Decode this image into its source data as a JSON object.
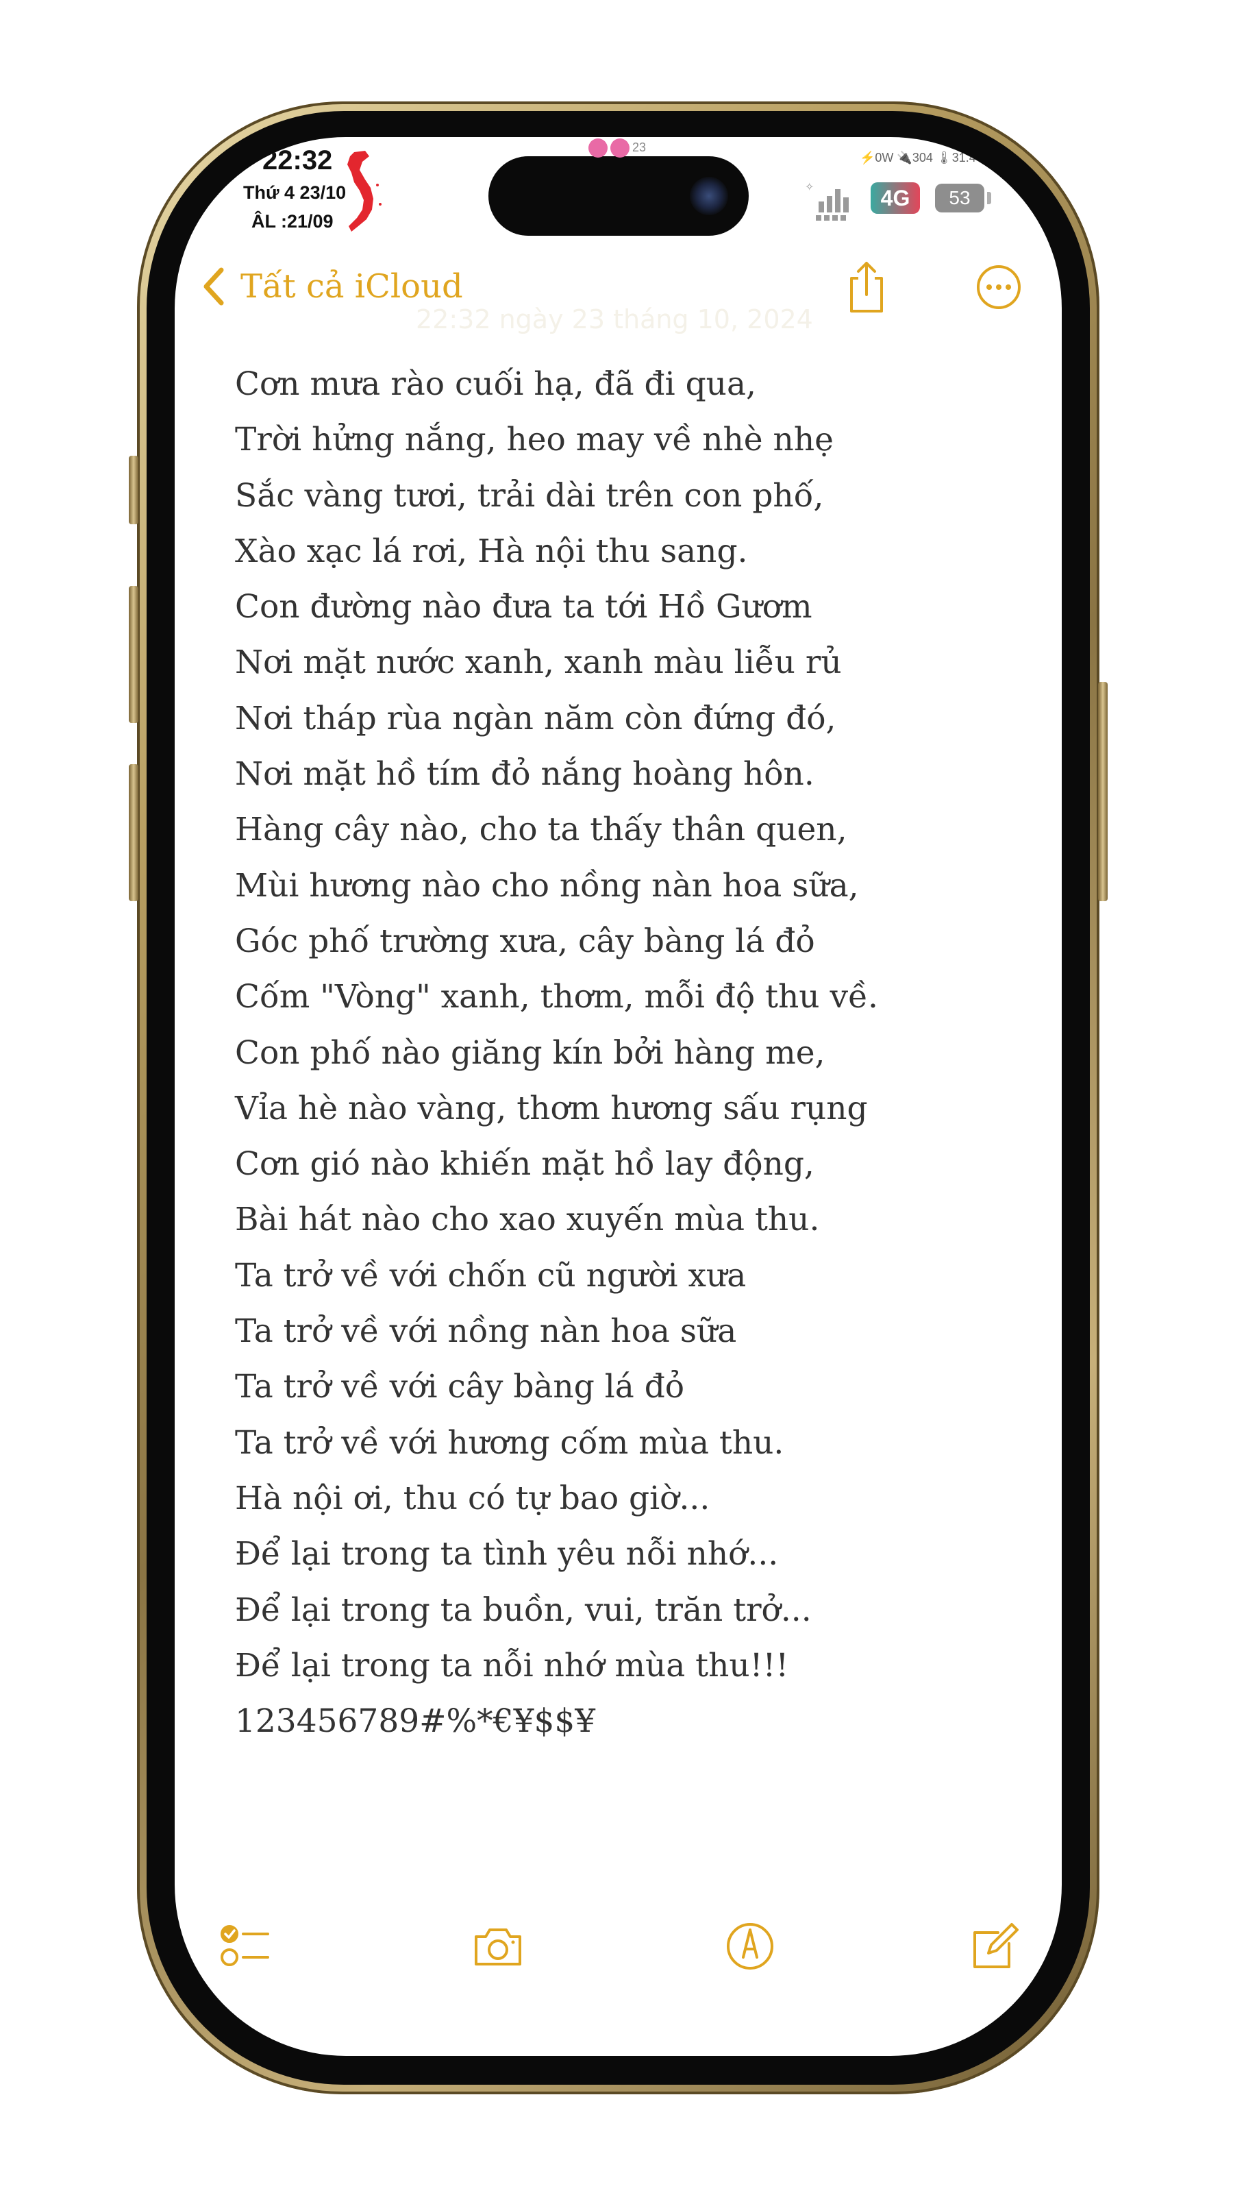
{
  "status_bar": {
    "time": "22:32",
    "date": "Thứ 4 23/10",
    "lunar_date": "ÂL :21/09",
    "mini_stats": "⚡0W  🔌304  🌡31.4°",
    "network": "4G",
    "battery": "53",
    "notif_count": "23"
  },
  "nav": {
    "back_label": "Tất cả iCloud",
    "timestamp": "22:32 ngày 23 tháng 10, 2024"
  },
  "note": {
    "lines": [
      "Cơn mưa rào cuối hạ, đã đi qua,",
      "Trời hửng nắng, heo may về nhè nhẹ",
      "Sắc vàng tươi, trải dài trên con phố,",
      "Xào xạc lá rơi, Hà nội thu sang.",
      "Con đường nào đưa ta tới Hồ Gươm",
      "Nơi mặt nước xanh, xanh màu liễu rủ",
      "Nơi tháp rùa ngàn năm còn đứng đó,",
      "Nơi mặt hồ tím đỏ nắng hoàng hôn.",
      "Hàng cây nào, cho ta thấy thân quen,",
      "Mùi hương nào cho nồng nàn hoa sữa,",
      "Góc phố trường xưa, cây bàng lá đỏ",
      "Cốm \"Vòng\" xanh, thơm, mỗi độ thu về.",
      "Con phố nào giăng kín bởi hàng me,",
      "Vỉa hè nào vàng, thơm hương sấu rụng",
      "Cơn gió nào khiến mặt hồ lay động,",
      "Bài hát nào cho xao xuyến mùa thu.",
      "Ta trở về với chốn cũ người xưa",
      "Ta trở về với nồng nàn hoa sữa",
      "Ta trở về với cây bàng lá đỏ",
      "Ta trở về với hương cốm mùa thu.",
      "Hà nội ơi, thu có tự bao giờ...",
      "Để lại trong ta tình yêu nỗi nhớ...",
      "Để lại trong ta buồn, vui, trăn trở...",
      "Để lại trong ta nỗi nhớ mùa thu!!!",
      "123456789#%*€¥$$¥"
    ]
  },
  "icons": {
    "back": "chevron-left-icon",
    "share": "share-icon",
    "more": "ellipsis-circle-icon",
    "checklist": "checklist-icon",
    "camera": "camera-icon",
    "markup": "markup-pen-icon",
    "compose": "compose-icon"
  },
  "colors": {
    "accent": "#e0a51f",
    "text": "#333333",
    "frame_gold": "#b89f62",
    "background": "#ffffff"
  }
}
